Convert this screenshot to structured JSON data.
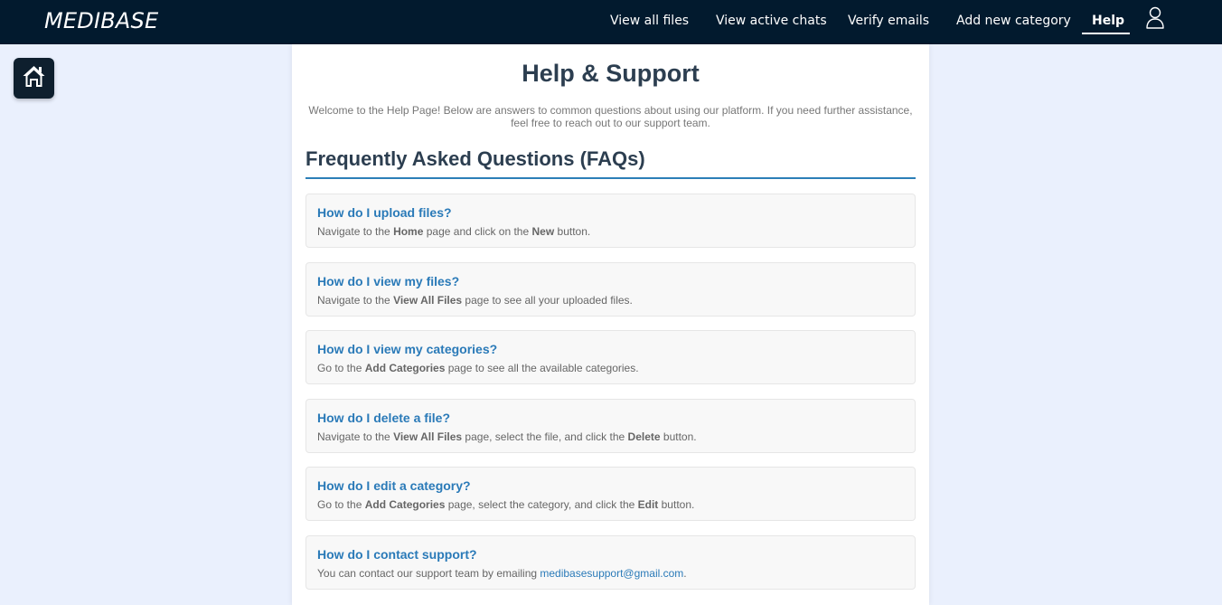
{
  "header": {
    "brand": "MEDIBASE",
    "nav": [
      {
        "label": "View all files"
      },
      {
        "label": "View active chats"
      },
      {
        "label": "Verify emails"
      },
      {
        "label": "Add new category"
      },
      {
        "label": "Help",
        "active": true
      }
    ],
    "user_icon": "user-icon"
  },
  "home_button": {
    "icon": "home-icon"
  },
  "main": {
    "title": "Help & Support",
    "intro": "Welcome to the Help Page! Below are answers to common questions about using our platform. If you need further assistance, feel free to reach out to our support team.",
    "faq_heading": "Frequently Asked Questions (FAQs)",
    "faqs": [
      {
        "question": "How do I upload files?",
        "answer": [
          "Navigate to the ",
          "Home",
          " page and click on the ",
          "New",
          " button."
        ]
      },
      {
        "question": "How do I view my files?",
        "answer": [
          "Navigate to the ",
          "View All Files",
          " page to see all your uploaded files."
        ]
      },
      {
        "question": "How do I view my categories?",
        "answer": [
          "Go to the ",
          "Add Categories",
          " page to see all the available categories."
        ]
      },
      {
        "question": "How do I delete a file?",
        "answer": [
          "Navigate to the ",
          "View All Files",
          " page, select the file, and click the ",
          "Delete",
          " button."
        ]
      },
      {
        "question": "How do I edit a category?",
        "answer": [
          "Go to the ",
          "Add Categories",
          " page, select the category, and click the ",
          "Edit",
          " button."
        ]
      },
      {
        "question": "How do I contact support?",
        "answer_prefix": "You can contact our support team by emailing ",
        "email": "medibasesupport@gmail.com",
        "answer_suffix": "."
      }
    ]
  },
  "colors": {
    "navbar": "#021a2e",
    "accent": "#2a7ab8",
    "page_bg": "#eaf0fd",
    "heading": "#2c3e50"
  }
}
